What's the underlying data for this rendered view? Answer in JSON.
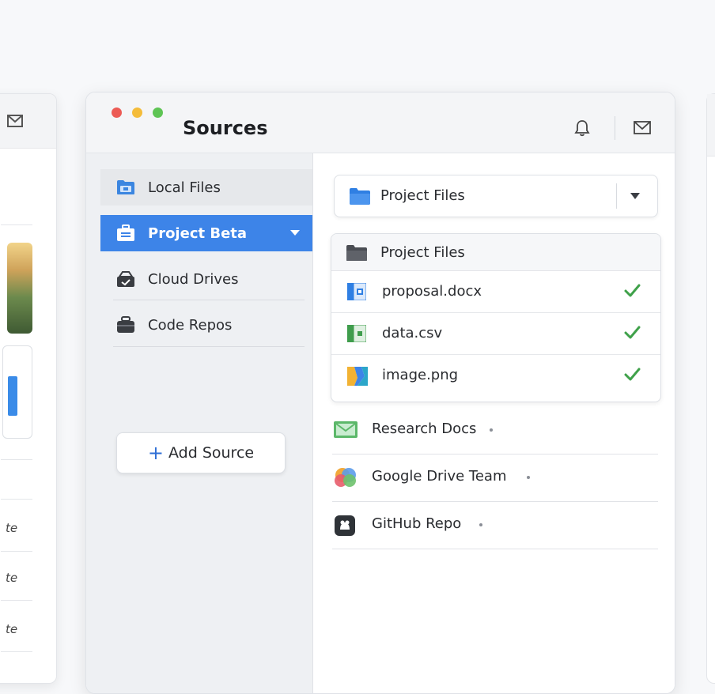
{
  "left_window": {
    "rows": [
      "te",
      "te",
      "te"
    ]
  },
  "window": {
    "title": "Sources"
  },
  "sidebar": {
    "items": [
      {
        "label": "Local Files",
        "icon": "folder-icon"
      },
      {
        "label": "Project Beta",
        "icon": "briefcase-icon",
        "active": true
      },
      {
        "label": "Cloud Drives",
        "icon": "cloud-bag-icon"
      },
      {
        "label": "Code Repos",
        "icon": "bag-icon"
      }
    ],
    "add_button": {
      "plus": "+",
      "label": "Add Source"
    }
  },
  "source_select": {
    "selected": "Project Files"
  },
  "file_panel": {
    "header": "Project Files",
    "files": [
      {
        "name": "proposal.docx",
        "icon": "docx-file-icon",
        "synced": true
      },
      {
        "name": "data.csv",
        "icon": "csv-file-icon",
        "synced": true
      },
      {
        "name": "image.png",
        "icon": "image-file-icon",
        "synced": true
      }
    ]
  },
  "sources": [
    {
      "label": "Research Docs",
      "icon": "research-folder-icon"
    },
    {
      "label": "Google Drive Team",
      "icon": "google-drive-icon"
    },
    {
      "label": "GitHub Repo",
      "icon": "github-icon"
    }
  ],
  "colors": {
    "accent": "#3d84e8",
    "check": "#3fa14a",
    "traffic_red": "#ec5b55",
    "traffic_yellow": "#f4bc3a",
    "traffic_green": "#5ec454"
  }
}
